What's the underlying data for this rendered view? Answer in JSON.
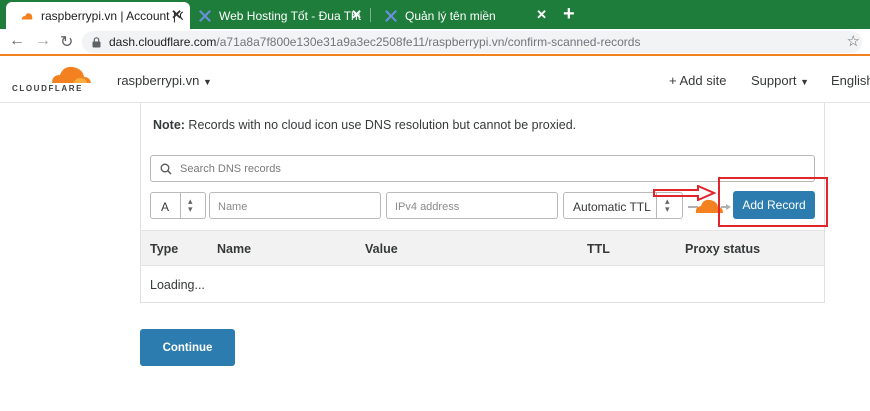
{
  "browser": {
    "tabs": [
      {
        "label": "raspberrypi.vn | Account | Cloudfl",
        "active": true,
        "icon": "cloudflare-icon"
      },
      {
        "label": "Web Hosting Tốt - Đua Thương",
        "active": false,
        "icon": "hosting-icon"
      },
      {
        "label": "Quản lý tên miền",
        "active": false,
        "icon": "hosting-icon"
      }
    ],
    "close_glyph": "✕",
    "new_tab_glyph": "+",
    "address": {
      "domain": "dash.cloudflare.com",
      "path": "/a71a8a7f800e130e31a9a3ec2508fe11/raspberrypi.vn/confirm-scanned-records"
    },
    "tab_bar_color": "#1e7d3a"
  },
  "header": {
    "logo_text": "CLOUDFLARE",
    "account": "raspberrypi.vn",
    "add_site": "+ Add site",
    "support": "Support",
    "language": "English"
  },
  "dns": {
    "note_bold": "Note:",
    "note_text": " Records with no cloud icon use DNS resolution but cannot be proxied.",
    "search_placeholder": "Search DNS records",
    "type_value": "A",
    "name_placeholder": "Name",
    "value_placeholder": "IPv4 address",
    "ttl_value": "Automatic TTL",
    "add_record": "Add Record",
    "columns": [
      "Type",
      "Name",
      "Value",
      "TTL",
      "Proxy status"
    ],
    "loading_text": "Loading...",
    "continue": "Continue"
  },
  "colors": {
    "accent_orange": "#f48120",
    "button_blue": "#2c7cb0",
    "highlight_red": "#e0262c"
  }
}
